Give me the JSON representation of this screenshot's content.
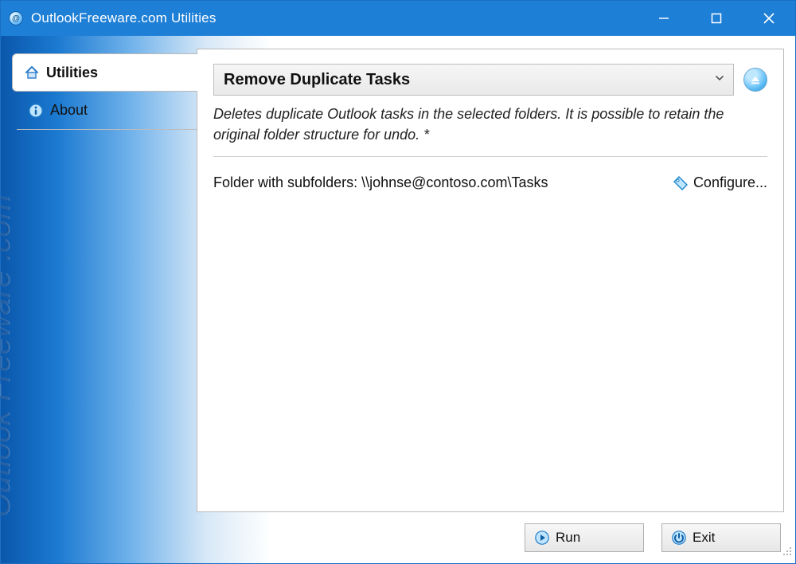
{
  "window": {
    "title": "OutlookFreeware.com Utilities"
  },
  "sidebar": {
    "tabs": [
      {
        "label": "Utilities"
      },
      {
        "label": "About"
      }
    ],
    "brand_text": "Outlook Freeware .com"
  },
  "panel": {
    "heading": "Remove Duplicate Tasks",
    "description": "Deletes duplicate Outlook tasks in the selected folders. It is possible to retain the original folder structure for undo. *",
    "folder_label": "Folder with subfolders: \\\\johnse@contoso.com\\Tasks",
    "configure_label": "Configure..."
  },
  "footer": {
    "run_label": "Run",
    "exit_label": "Exit"
  }
}
